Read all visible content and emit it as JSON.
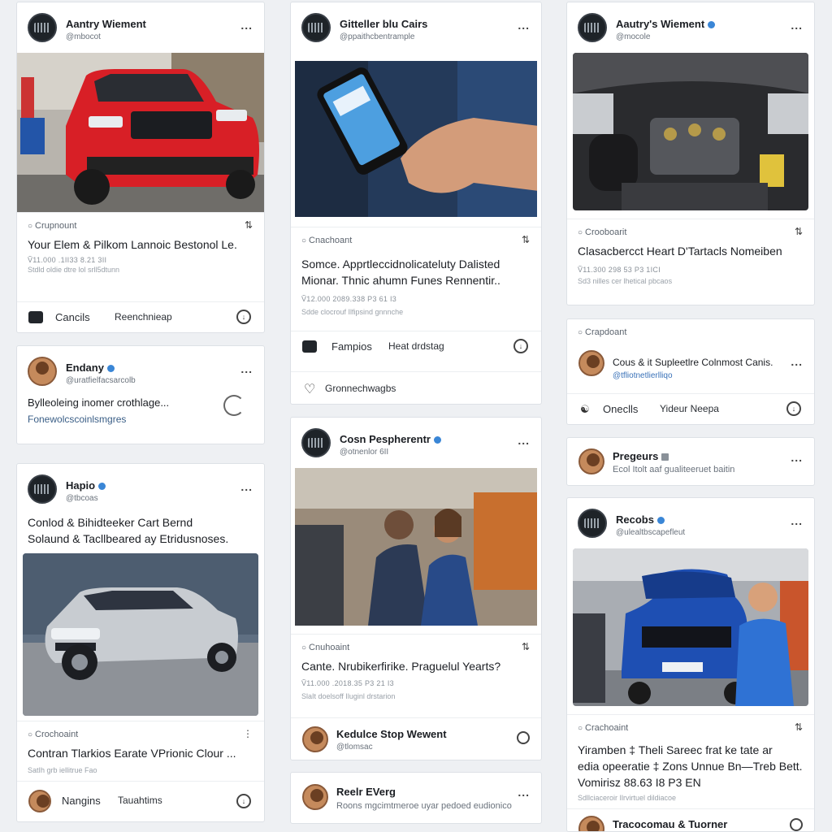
{
  "colors": {
    "accent": "#3a86d6",
    "jeep": "#d81f26",
    "suv_blue": "#1e4fb3",
    "shirt_blue": "#2f72d4"
  },
  "icons": [
    "more-icon",
    "refresh-icon",
    "heart-icon",
    "bookmark-icon",
    "verified-icon",
    "share-icon"
  ],
  "more_label": "...",
  "col1": {
    "card1": {
      "name": "Aantry Wiement",
      "handle": "@mbocot",
      "source": "Crupnount",
      "headline": "Your Elem & Pilkom Lannoic Bestonol Le.",
      "stat": "Ṽ11.000 .1II33 8.21 3II",
      "sub": "Stdld oldie dtre lol srll5dtunn",
      "action1": "Cancils",
      "action2": "Reenchnieap"
    },
    "card2": {
      "name": "Endany",
      "handle": "@uratfielfacsarcolb",
      "body": "Bylleoleing inomer crothlage...",
      "link": "Fonewolcscoinlsmgres"
    },
    "card3": {
      "name": "Hapio",
      "handle": "@tbcoas",
      "title_line1": "Conlod & Bihidteeker Cart Bernd",
      "title_line2": "Solaund & Tacllbeared ay Etridusnoses.",
      "source": "Crochoaint",
      "headline": "Contran Tlarkios Earate VPrionic Clour ...",
      "sub": "SatIh grb iellitrue Fao",
      "action1": "Nangins",
      "action2": "Tauahtims"
    }
  },
  "col2": {
    "card1": {
      "name": "Gitteller blu Cairs",
      "handle": "@ppaithcbentrample",
      "source": "Cnachoant",
      "headline_line1": "Somce. Apprtleccidnolicateluty Dalisted",
      "headline_line2": "Mionar. Thnic ahumn Funes Rennentir..",
      "stat": "Ṽ12.000 2089.338 P3 61 I3",
      "sub": "Sdde clocrouf Ilfipsind gnnnche",
      "action1": "Fampios",
      "action2": "Heat drdstag",
      "like_label": "Gronnechwagbs"
    },
    "card2": {
      "name": "Cosn Pespherentr",
      "handle": "@otnenlor 6II",
      "source": "Cnuhoaint",
      "headline": "Cante. Nrubikerfirike. Praguelul Yearts?",
      "stat": "Ṽ11.000 .2018.35 P3 21 I3",
      "sub": "SlaIt doelsoff Iluginl drstarion",
      "user_name": "Kedulce Stop Wewent",
      "user_handle": "@tlomsac"
    },
    "card3": {
      "name": "Reelr EVerg",
      "handle": "Roons mgcimtmeroe uyar pedoed eudionico"
    }
  },
  "col3": {
    "card1": {
      "name": "Aautry's Wiement",
      "handle": "@mocole",
      "source": "Crooboarit",
      "headline": "Clasacbercct Heart D'Tartacls Nomeiben",
      "stat": "Ṽ11.300 298 53 P3 1ICI",
      "sub": "Sd3 nilles cer lhetical pbcaos"
    },
    "card2": {
      "source": "Crapdoant",
      "user_text": "Cous & it Supleetlre Colnmost Canis.",
      "user_link": "@tfliotnetlierlliqo",
      "action1": "Oneclls",
      "action2": "Yideur Neepa"
    },
    "card3": {
      "name": "Pregeurs",
      "handle": "Ecol Itolt aaf gualiteeruet baitin"
    },
    "card4": {
      "name": "Recobs",
      "handle": "@ulealtbscapefleut",
      "source": "Crachoaint",
      "headline_line1": "Yiramben ‡ Theli Sareec frat ke tate ar",
      "headline_line2": "edia opeeratie ‡ Zons Unnue Bn—Treb Bett.",
      "headline_line3": "Vomirisz 88.63 I8 P3 EN",
      "sub": "Sdllciaceroir Ilrvirtuel dildiacoe",
      "footer_name": "Tracocomau & Tuorner"
    }
  }
}
